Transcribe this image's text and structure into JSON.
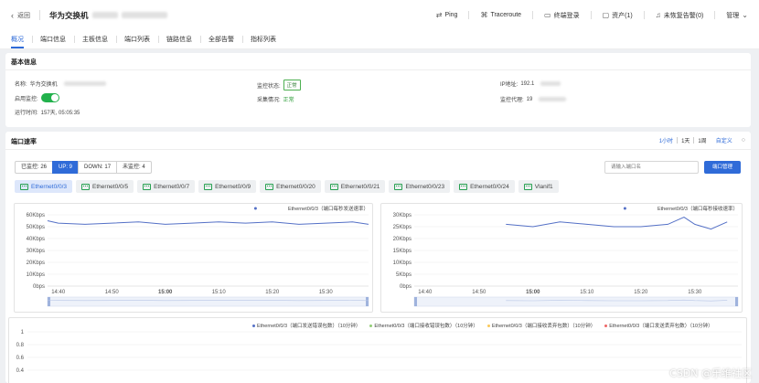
{
  "header": {
    "back_label": "返回",
    "device_name": "华为交换机",
    "actions": [
      {
        "name": "ping-button",
        "icon": "ping-icon",
        "label": "Ping"
      },
      {
        "name": "traceroute-button",
        "icon": "traceroute-icon",
        "label": "Traceroute"
      },
      {
        "name": "terminal-login-button",
        "icon": "terminal-icon",
        "label": "终端登录"
      },
      {
        "name": "assets-button",
        "icon": "folder-icon",
        "label": "资产(1)"
      },
      {
        "name": "unrecovered-alarm-button",
        "icon": "bell-icon",
        "label": "未恢复告警(0)"
      },
      {
        "name": "manage-menu",
        "icon": "chevron-down-icon",
        "label": "管理"
      }
    ]
  },
  "tabs": [
    {
      "label": "概况",
      "active": true
    },
    {
      "label": "端口信息"
    },
    {
      "label": "主板信息"
    },
    {
      "label": "端口列表"
    },
    {
      "label": "链路信息"
    },
    {
      "label": "全部告警"
    },
    {
      "label": "指标列表"
    }
  ],
  "basic_info": {
    "title": "基本信息",
    "name_label": "名称:",
    "name_value": "华为交换机",
    "enable_monitor_label": "启用监控:",
    "enable_monitor_on": true,
    "uptime_label": "运行时间:",
    "uptime_value": "157天, 05:05:35",
    "monitor_status_label": "监控状态:",
    "monitor_status_value": "正常",
    "collect_status_label": "采集情况:",
    "collect_status_value": "正常",
    "ip_label": "IP地址:",
    "ip_value": "192.1",
    "proxy_label": "监控代理:",
    "proxy_value": "19"
  },
  "port_rate": {
    "title": "端口速率",
    "time_ranges": [
      {
        "label": "1小时",
        "active": true
      },
      {
        "label": "1天"
      },
      {
        "label": "1周"
      }
    ],
    "custom_label": "自定义",
    "filters": [
      {
        "label": "已监控: 26"
      },
      {
        "label": "UP: 9",
        "active": true
      },
      {
        "label": "DOWN: 17"
      },
      {
        "label": "未监控: 4"
      }
    ],
    "search_placeholder": "请输入端口名",
    "manage_button": "端口管理",
    "ports": [
      {
        "label": "Ethernet0/0/3",
        "active": true
      },
      {
        "label": "Ethernet0/0/5"
      },
      {
        "label": "Ethernet0/0/7"
      },
      {
        "label": "Ethernet0/0/9"
      },
      {
        "label": "Ethernet0/0/20"
      },
      {
        "label": "Ethernet0/0/21"
      },
      {
        "label": "Ethernet0/0/23"
      },
      {
        "label": "Ethernet0/0/24"
      },
      {
        "label": "Vlanif1"
      }
    ]
  },
  "chart_data": [
    {
      "type": "line",
      "series": [
        {
          "name": "Ethernet0/0/3（端口每秒发送速率）",
          "color": "#5470c6",
          "x": [
            "14:38",
            "14:40",
            "14:45",
            "14:50",
            "14:55",
            "15:00",
            "15:05",
            "15:10",
            "15:15",
            "15:20",
            "15:25",
            "15:30",
            "15:35",
            "15:38"
          ],
          "values": [
            55,
            53,
            52,
            53,
            54,
            52,
            53,
            54,
            53,
            54,
            52,
            53,
            54,
            52
          ]
        }
      ],
      "x_ticks": [
        "14:40",
        "14:50",
        "15:00",
        "15:10",
        "15:20",
        "15:30"
      ],
      "y_ticks": [
        "0bps",
        "10Kbps",
        "20Kbps",
        "30Kbps",
        "40Kbps",
        "50Kbps",
        "60Kbps"
      ],
      "ylim": [
        0,
        60
      ],
      "grid": true,
      "legend": "top-right"
    },
    {
      "type": "line",
      "series": [
        {
          "name": "Ethernet0/0/3（端口每秒接收速率）",
          "color": "#5470c6",
          "x": [
            "14:55",
            "15:00",
            "15:05",
            "15:10",
            "15:15",
            "15:20",
            "15:25",
            "15:28",
            "15:30",
            "15:33",
            "15:36"
          ],
          "values": [
            26,
            25,
            27,
            26,
            25,
            25,
            26,
            29,
            26,
            24,
            27
          ]
        }
      ],
      "x_ticks": [
        "14:40",
        "14:50",
        "15:00",
        "15:10",
        "15:20",
        "15:30"
      ],
      "y_ticks": [
        "0bps",
        "5Kbps",
        "10Kbps",
        "15Kbps",
        "20Kbps",
        "25Kbps",
        "30Kbps"
      ],
      "ylim": [
        0,
        30
      ],
      "grid": true,
      "legend": "top-right"
    },
    {
      "type": "line",
      "series": [
        {
          "name": "Ethernet0/0/3（端口发送错误包数）（10分钟）",
          "color": "#5470c6",
          "values": []
        },
        {
          "name": "Ethernet0/0/3（端口接收错误包数）（10分钟）",
          "color": "#91cc75",
          "values": []
        },
        {
          "name": "Ethernet0/0/3（端口接收丢弃包数）（10分钟）",
          "color": "#fac858",
          "values": []
        },
        {
          "name": "Ethernet0/0/3（端口发送丢弃包数）（10分钟）",
          "color": "#ee6666",
          "values": []
        }
      ],
      "y_ticks": [
        "1",
        "0.8",
        "0.6",
        "0.4"
      ],
      "legend": "top-right"
    }
  ],
  "watermark": "CSDN @乐维社区"
}
